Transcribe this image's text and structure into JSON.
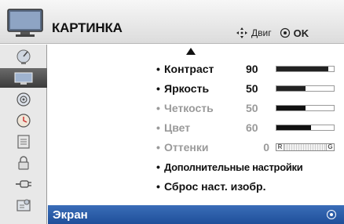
{
  "header": {
    "title": "КАРТИНКА",
    "icon": "tv-icon",
    "nav_label": "Двиг",
    "ok_label": "OK"
  },
  "sidebar": {
    "items": [
      {
        "icon": "satellite-dish-icon",
        "active": false
      },
      {
        "icon": "tv-screen-icon",
        "active": true
      },
      {
        "icon": "speaker-icon",
        "active": false
      },
      {
        "icon": "clock-icon",
        "active": false
      },
      {
        "icon": "lock-icon",
        "active": false
      },
      {
        "icon": "padlock-icon",
        "active": false
      },
      {
        "icon": "plug-icon",
        "active": false
      },
      {
        "icon": "settings-panel-icon",
        "active": false
      }
    ]
  },
  "menu": {
    "items": [
      {
        "label": "Контраст",
        "value": "90",
        "level": 0.9,
        "enabled": true
      },
      {
        "label": "Яркость",
        "value": "50",
        "level": 0.5,
        "enabled": true
      },
      {
        "label": "Четкость",
        "value": "50",
        "level": 0.5,
        "enabled": false
      },
      {
        "label": "Цвет",
        "value": "60",
        "level": 0.6,
        "enabled": false
      },
      {
        "label": "Оттенки",
        "value": "0",
        "tint_left": "R",
        "tint_right": "G",
        "enabled": false
      },
      {
        "label": "Дополнительные настройки",
        "enabled": true
      },
      {
        "label": "Сброс наст. изобр.",
        "enabled": true
      }
    ]
  },
  "footer": {
    "label": "Экран",
    "selected": true
  },
  "colors": {
    "highlight": "#2a5ca8",
    "dim_text": "#9a9a9a"
  }
}
